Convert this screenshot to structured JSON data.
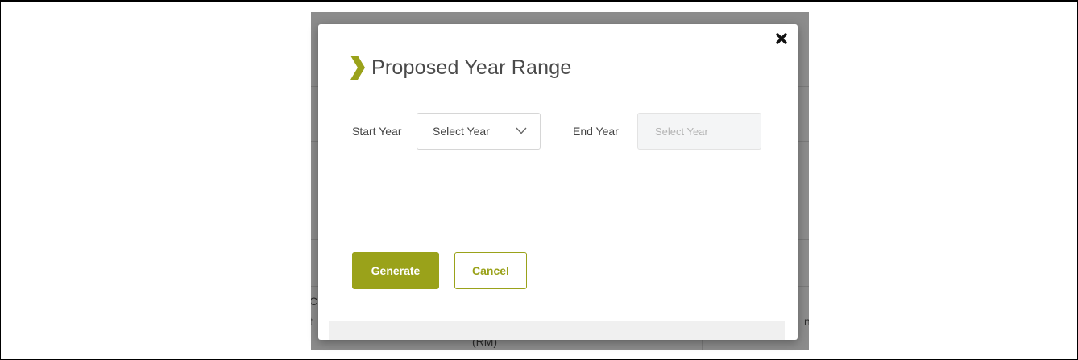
{
  "background": {
    "fragment_c": "C",
    "fragment_t": "t",
    "fragment_rm": "(RM)",
    "fragment_n": "n"
  },
  "modal": {
    "title": "Proposed Year Range",
    "close_icon": "close-icon",
    "start_year_label": "Start Year",
    "start_year_value": "Select Year",
    "end_year_label": "End Year",
    "end_year_placeholder": "Select Year",
    "generate_label": "Generate",
    "cancel_label": "Cancel"
  },
  "colors": {
    "accent": "#9aa21a",
    "title_text": "#4a4a4a",
    "overlay": "#8c8c8c"
  }
}
